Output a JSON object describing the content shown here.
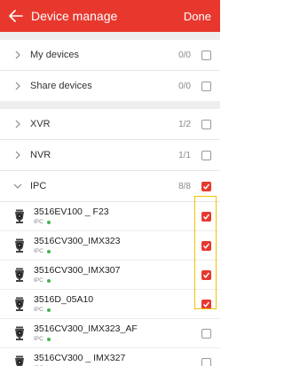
{
  "header": {
    "title": "Device manage",
    "done_label": "Done"
  },
  "groups_top": [
    {
      "label": "My devices",
      "count": "0/0",
      "checked": false
    },
    {
      "label": "Share devices",
      "count": "0/0",
      "checked": false
    }
  ],
  "groups": [
    {
      "label": "XVR",
      "count": "1/2",
      "checked": false
    },
    {
      "label": "NVR",
      "count": "1/1",
      "checked": false
    },
    {
      "label": "IPC",
      "count": "8/8",
      "checked": true
    }
  ],
  "devices": [
    {
      "name": "3516EV100 _ F23",
      "type": "IPC",
      "online": true,
      "checked": true
    },
    {
      "name": "3516CV300_IMX323",
      "type": "IPC",
      "online": true,
      "checked": true
    },
    {
      "name": "3516CV300_IMX307",
      "type": "IPC",
      "online": true,
      "checked": true
    },
    {
      "name": "3516D_05A10",
      "type": "IPC",
      "online": true,
      "checked": true
    },
    {
      "name": "3516CV300_IMX323_AF",
      "type": "IPC",
      "online": true,
      "checked": false
    },
    {
      "name": "3516CV300 _ IMX327",
      "type": "IPC",
      "online": true,
      "checked": false
    }
  ],
  "colors": {
    "accent": "#e8382e",
    "online": "#4caf50",
    "highlight": "#f2c200"
  }
}
